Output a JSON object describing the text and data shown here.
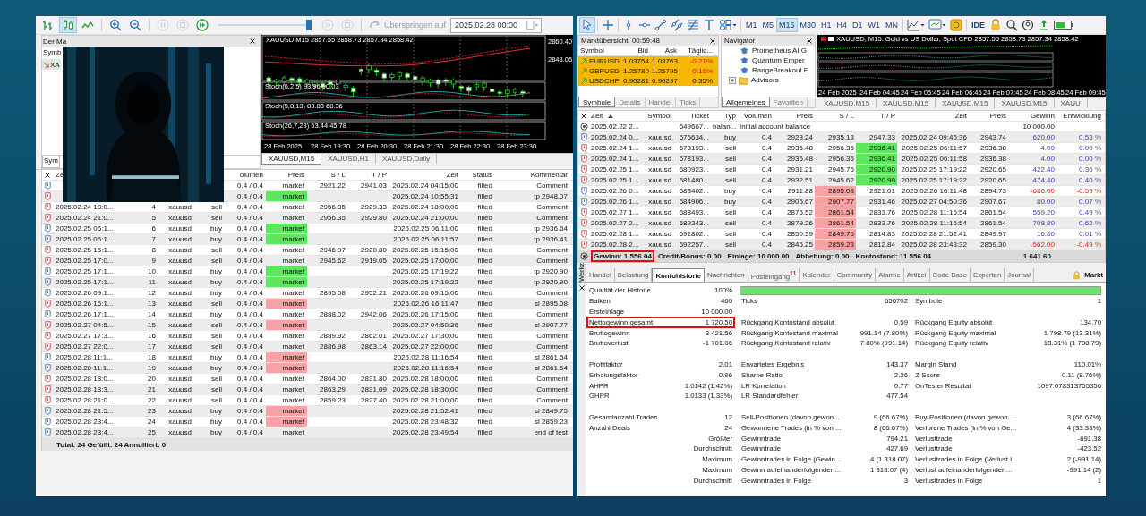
{
  "left_toolbar": {
    "tools": [
      {
        "kind": "bars",
        "selected": false,
        "disabled": false
      },
      {
        "kind": "candles",
        "selected": true,
        "disabled": false
      },
      {
        "kind": "line",
        "selected": false,
        "disabled": false
      },
      {
        "kind": "zoom-in",
        "selected": false,
        "disabled": false
      },
      {
        "kind": "zoom-out",
        "selected": false,
        "disabled": false
      },
      {
        "kind": "pause",
        "selected": false,
        "disabled": true
      },
      {
        "kind": "stop",
        "selected": false,
        "disabled": true
      },
      {
        "kind": "play",
        "selected": false,
        "disabled": false
      }
    ],
    "speed": {
      "level": 0.97
    },
    "after_tools": [
      {
        "kind": "forward",
        "selected": false,
        "disabled": true
      },
      {
        "kind": "stop",
        "selected": false,
        "disabled": true
      }
    ],
    "skip_label": "Überspringen auf",
    "date_field": {
      "value": "2025.02.28 00:00"
    }
  },
  "market_panel": {
    "title": "Der Ma",
    "column": "Symb",
    "row": "XA",
    "tab": "Sym"
  },
  "left_chart": {
    "title": "XAUUSD,M15  2857.55 2858.73 2857.34 2858.42",
    "price_labels": [
      "2860.40",
      "2848.05"
    ],
    "indicators": [
      "Stoch(6,2,5) 93.96 90.03",
      "Stoch(5,8,13) 83.83 68.36",
      "Stoch(26,7,28) 53.44 45.78"
    ],
    "time_labels": [
      "28 Feb 2025",
      "28 Feb 19:30",
      "28 Feb 20:30",
      "28 Feb 21:30",
      "28 Feb 22:30",
      "28 Feb 23:30"
    ],
    "tabs": [
      {
        "label": "XAUUSD,M15",
        "selected": true
      },
      {
        "label": "XAUUSD,H1",
        "selected": false
      },
      {
        "label": "XAUUSD,Daily",
        "selected": false
      }
    ]
  },
  "orders": {
    "header": {
      "zeit": "Ze",
      "volumen": "olumen",
      "preis": "Preis",
      "sl": "S / L",
      "tp": "T / P",
      "zeit2": "Zeit",
      "status": "Status",
      "kommentar": "Kommentar"
    },
    "rows": [
      {
        "kind": "buy",
        "tp_hit": false,
        "sl_hit": false,
        "volumen": "0.4 / 0.4",
        "preis": "market",
        "sl": "2921.22",
        "tp": "2941.03",
        "zeit2": "2025.02.24 04:15:00",
        "status": "filled",
        "kommentar": "Comment"
      },
      {
        "kind": "sell",
        "tp_hit": true,
        "sl_hit": false,
        "volumen": "0.4 / 0.4",
        "preis": "market",
        "zeit2": "2025.02.24 10:55:31",
        "status": "filled",
        "kommentar": "tp 2948.07"
      },
      {
        "kind": "sell",
        "tp_hit": false,
        "sl_hit": false,
        "zeit": "2025.02.24 18:0...",
        "order": "4",
        "symbol": "xauusd",
        "typ": "sell",
        "volumen": "0.4 / 0.4",
        "preis": "market",
        "sl": "2956.35",
        "tp": "2929.33",
        "zeit2": "2025.02.24 18:00:00",
        "status": "filled",
        "kommentar": "Comment"
      },
      {
        "kind": "sell",
        "tp_hit": false,
        "sl_hit": false,
        "zeit": "2025.02.24 21:0...",
        "order": "5",
        "symbol": "xauusd",
        "typ": "sell",
        "volumen": "0.4 / 0.4",
        "preis": "market",
        "sl": "2956.35",
        "tp": "2929.80",
        "zeit2": "2025.02.24 21:00:00",
        "status": "filled",
        "kommentar": "Comment"
      },
      {
        "kind": "buy",
        "tp_hit": true,
        "sl_hit": false,
        "zeit": "2025.02.25 06:1...",
        "order": "6",
        "symbol": "xauusd",
        "typ": "buy",
        "volumen": "0.4 / 0.4",
        "preis": "market",
        "zeit2": "2025.02.25 06:11:00",
        "status": "filled",
        "kommentar": "tp 2936.64"
      },
      {
        "kind": "buy",
        "tp_hit": true,
        "sl_hit": false,
        "zeit": "2025.02.25 06:1...",
        "order": "7",
        "symbol": "xauusd",
        "typ": "buy",
        "volumen": "0.4 / 0.4",
        "preis": "market",
        "zeit2": "2025.02.25 06:11:57",
        "status": "filled",
        "kommentar": "tp 2936.41"
      },
      {
        "kind": "sell",
        "tp_hit": false,
        "sl_hit": false,
        "zeit": "2025.02.25 15:1...",
        "order": "8",
        "symbol": "xauusd",
        "typ": "sell",
        "volumen": "0.4 / 0.4",
        "preis": "market",
        "sl": "2946.97",
        "tp": "2920.80",
        "zeit2": "2025.02.25 15:15:00",
        "status": "filled",
        "kommentar": "Comment"
      },
      {
        "kind": "sell",
        "tp_hit": false,
        "sl_hit": false,
        "zeit": "2025.02.25 17:0...",
        "order": "9",
        "symbol": "xauusd",
        "typ": "sell",
        "volumen": "0.4 / 0.4",
        "preis": "market",
        "sl": "2945.62",
        "tp": "2919.05",
        "zeit2": "2025.02.25 17:00:00",
        "status": "filled",
        "kommentar": "Comment"
      },
      {
        "kind": "buy",
        "tp_hit": true,
        "sl_hit": false,
        "zeit": "2025.02.25 17:1...",
        "order": "10",
        "symbol": "xauusd",
        "typ": "buy",
        "volumen": "0.4 / 0.4",
        "preis": "market",
        "zeit2": "2025.02.25 17:19:22",
        "status": "filled",
        "kommentar": "tp 2920.90"
      },
      {
        "kind": "buy",
        "tp_hit": true,
        "sl_hit": false,
        "zeit": "2025.02.25 17:1...",
        "order": "11",
        "symbol": "xauusd",
        "typ": "buy",
        "volumen": "0.4 / 0.4",
        "preis": "market",
        "zeit2": "2025.02.25 17:19:22",
        "status": "filled",
        "kommentar": "tp 2920.90"
      },
      {
        "kind": "buy",
        "tp_hit": false,
        "sl_hit": false,
        "zeit": "2025.02.26 09:1...",
        "order": "12",
        "symbol": "xauusd",
        "typ": "buy",
        "volumen": "0.4 / 0.4",
        "preis": "market",
        "sl": "2895.08",
        "tp": "2952.21",
        "zeit2": "2025.02.26 09:15:00",
        "status": "filled",
        "kommentar": "Comment"
      },
      {
        "kind": "sell",
        "tp_hit": false,
        "sl_hit": true,
        "zeit": "2025.02.26 16:1...",
        "order": "13",
        "symbol": "xauusd",
        "typ": "sell",
        "volumen": "0.4 / 0.4",
        "preis": "market",
        "zeit2": "2025.02.26 16:11:47",
        "status": "filled",
        "kommentar": "sl 2895.08"
      },
      {
        "kind": "buy",
        "tp_hit": false,
        "sl_hit": false,
        "zeit": "2025.02.26 17:1...",
        "order": "14",
        "symbol": "xauusd",
        "typ": "buy",
        "volumen": "0.4 / 0.4",
        "preis": "market",
        "sl": "2888.02",
        "tp": "2942.06",
        "zeit2": "2025.02.26 17:15:00",
        "status": "filled",
        "kommentar": "Comment"
      },
      {
        "kind": "sell",
        "tp_hit": false,
        "sl_hit": true,
        "zeit": "2025.02.27 04:5...",
        "order": "15",
        "symbol": "xauusd",
        "typ": "sell",
        "volumen": "0.4 / 0.4",
        "preis": "market",
        "zeit2": "2025.02.27 04:50:36",
        "status": "filled",
        "kommentar": "sl 2907.77"
      },
      {
        "kind": "sell",
        "tp_hit": false,
        "sl_hit": false,
        "zeit": "2025.02.27 17:3...",
        "order": "16",
        "symbol": "xauusd",
        "typ": "sell",
        "volumen": "0.4 / 0.4",
        "preis": "market",
        "sl": "2889.92",
        "tp": "2862.01",
        "zeit2": "2025.02.27 17:30:00",
        "status": "filled",
        "kommentar": "Comment"
      },
      {
        "kind": "sell",
        "tp_hit": false,
        "sl_hit": false,
        "zeit": "2025.02.27 22:0...",
        "order": "17",
        "symbol": "xauusd",
        "typ": "sell",
        "volumen": "0.4 / 0.4",
        "preis": "market",
        "sl": "2886.98",
        "tp": "2863.14",
        "zeit2": "2025.02.27 22:00:00",
        "status": "filled",
        "kommentar": "Comment"
      },
      {
        "kind": "buy",
        "tp_hit": false,
        "sl_hit": true,
        "zeit": "2025.02.28 11:1...",
        "order": "18",
        "symbol": "xauusd",
        "typ": "buy",
        "volumen": "0.4 / 0.4",
        "preis": "market",
        "zeit2": "2025.02.28 11:16:54",
        "status": "filled",
        "kommentar": "sl 2861.54"
      },
      {
        "kind": "buy",
        "tp_hit": false,
        "sl_hit": true,
        "zeit": "2025.02.28 11:1...",
        "order": "19",
        "symbol": "xauusd",
        "typ": "buy",
        "volumen": "0.4 / 0.4",
        "preis": "market",
        "zeit2": "2025.02.28 11:16:54",
        "status": "filled",
        "kommentar": "sl 2861.54"
      },
      {
        "kind": "sell",
        "tp_hit": false,
        "sl_hit": false,
        "zeit": "2025.02.28 18:0...",
        "order": "20",
        "symbol": "xauusd",
        "typ": "sell",
        "volumen": "0.4 / 0.4",
        "preis": "market",
        "sl": "2864.00",
        "tp": "2831.80",
        "zeit2": "2025.02.28 18:00:00",
        "status": "filled",
        "kommentar": "Comment"
      },
      {
        "kind": "sell",
        "tp_hit": false,
        "sl_hit": false,
        "zeit": "2025.02.28 18:3...",
        "order": "21",
        "symbol": "xauusd",
        "typ": "sell",
        "volumen": "0.4 / 0.4",
        "preis": "market",
        "sl": "2863.29",
        "tp": "2831.09",
        "zeit2": "2025.02.28 18:30:00",
        "status": "filled",
        "kommentar": "Comment"
      },
      {
        "kind": "sell",
        "tp_hit": false,
        "sl_hit": false,
        "zeit": "2025.02.28 21:0...",
        "order": "22",
        "symbol": "xauusd",
        "typ": "sell",
        "volumen": "0.4 / 0.4",
        "preis": "market",
        "sl": "2859.23",
        "tp": "2827.40",
        "zeit2": "2025.02.28 21:00:00",
        "status": "filled",
        "kommentar": "Comment"
      },
      {
        "kind": "buy",
        "tp_hit": false,
        "sl_hit": true,
        "zeit": "2025.02.28 21:5...",
        "order": "23",
        "symbol": "xauusd",
        "typ": "buy",
        "volumen": "0.4 / 0.4",
        "preis": "market",
        "zeit2": "2025.02.28 21:52:41",
        "status": "filled",
        "kommentar": "sl 2849.75"
      },
      {
        "kind": "buy",
        "tp_hit": false,
        "sl_hit": true,
        "zeit": "2025.02.28 23:4...",
        "order": "24",
        "symbol": "xauusd",
        "typ": "buy",
        "volumen": "0.4 / 0.4",
        "preis": "market",
        "zeit2": "2025.02.28 23:48:32",
        "status": "filled",
        "kommentar": "sl 2859.23"
      },
      {
        "kind": "buy",
        "tp_hit": false,
        "sl_hit": false,
        "zeit": "2025.02.28 23:4...",
        "order": "25",
        "symbol": "xauusd",
        "typ": "buy",
        "volumen": "0.4 / 0.4",
        "preis": "market",
        "zeit2": "2025.02.28 23:49:54",
        "status": "filled",
        "kommentar": "end of test"
      }
    ],
    "footer": "Total: 24  Gefüllt: 24  Annulliert: 0"
  },
  "right_toolbar": {
    "tools": [
      {
        "kind": "cursor",
        "selected": true
      },
      {
        "kind": "crosshair",
        "selected": false
      },
      {
        "kind": "vline",
        "selected": false
      },
      {
        "kind": "hline",
        "selected": false
      },
      {
        "kind": "trendline",
        "selected": false
      },
      {
        "kind": "channel",
        "selected": false
      },
      {
        "kind": "levels",
        "selected": false
      },
      {
        "kind": "text",
        "selected": false
      },
      {
        "kind": "shapes",
        "selected": false
      }
    ],
    "timeframes": [
      {
        "label": "M1",
        "selected": false
      },
      {
        "label": "M5",
        "selected": false
      },
      {
        "label": "M15",
        "selected": true
      },
      {
        "label": "M30",
        "selected": false
      },
      {
        "label": "H1",
        "selected": false
      },
      {
        "label": "H4",
        "selected": false
      },
      {
        "label": "D1",
        "selected": false
      },
      {
        "label": "W1",
        "selected": false
      },
      {
        "label": "MN",
        "selected": false
      }
    ],
    "ide": "IDE"
  },
  "market_watch": {
    "title": "Marktübersicht: 00:59:48",
    "columns": [
      "Symbol",
      "Bid",
      "Ask",
      "Täglic..."
    ],
    "rows": [
      {
        "symbol": "EURUSD",
        "bid": "1.03754",
        "ask": "1.03763",
        "change": "-0.21%",
        "negative": true
      },
      {
        "symbol": "GBPUSD",
        "bid": "1.25780",
        "ask": "1.25795",
        "change": "-0.16%",
        "negative": true
      },
      {
        "symbol": "USDCHF",
        "bid": "0.90281",
        "ask": "0.90297",
        "change": "0.35%",
        "negative": false
      }
    ],
    "tabs": [
      {
        "label": "Symbole",
        "selected": true
      },
      {
        "label": "Details",
        "selected": false
      },
      {
        "label": "Handel",
        "selected": false
      },
      {
        "label": "Ticks",
        "selected": false
      }
    ]
  },
  "navigator": {
    "title": "Navigator",
    "items": [
      {
        "label": "Prometheus AI G",
        "kind": "expert"
      },
      {
        "label": "Quantum Emper",
        "kind": "expert"
      },
      {
        "label": "RangeBreakout E",
        "kind": "expert"
      },
      {
        "label": "Advisors",
        "kind": "folder"
      }
    ],
    "tabs": [
      {
        "label": "Allgemeines",
        "selected": true
      },
      {
        "label": "Favoriten",
        "selected": false
      }
    ]
  },
  "mini_chart": {
    "title": "XAUUSD, M15: Gold vs US Dollar, Spot CFD 2857.55 2858.73 2857.34 2858.42",
    "time_labels": [
      "24 Feb 2025",
      "24 Feb 04:45",
      "24 Feb 05:45",
      "24 Feb 06:45",
      "24 Feb 07:45",
      "24 Feb 08:45",
      "24 Feb 09:45"
    ],
    "tabs": [
      {
        "label": "XAUUSD,M15",
        "selected": false
      },
      {
        "label": "XAUUSD,M15",
        "selected": false
      },
      {
        "label": "XAUUSD,M15",
        "selected": false
      },
      {
        "label": "XAUUSD,M15",
        "selected": false
      },
      {
        "label": "XAUU",
        "selected": false
      }
    ]
  },
  "deals": {
    "columns": [
      "Zeit",
      "Symbol",
      "Ticket",
      "Typ",
      "Volumen",
      "Preis",
      "S / L",
      "T / P",
      "Zeit",
      "Preis",
      "Gewinn",
      "Entwicklung"
    ],
    "rows": [
      {
        "kind": "balance",
        "zeit": "2025.02.22 2...",
        "ticket": "649667...",
        "typ": "balan...",
        "volumen": "Initial account balance",
        "gewinn": "10 000.00"
      },
      {
        "kind": "buy",
        "tp_hit": false,
        "sl_hit": false,
        "loss": false,
        "zeit": "2025.02.24 0...",
        "symbol": "xauusd",
        "ticket": "675634...",
        "typ": "buy",
        "volumen": "0.4",
        "preis": "2928.24",
        "sl": "2935.13",
        "tp": "2947.33",
        "zeit2": "2025.02.24 09:45:36",
        "preis2": "2943.74",
        "gewinn": "620.00",
        "entw": "0.53 %"
      },
      {
        "kind": "sell",
        "tp_hit": true,
        "sl_hit": false,
        "loss": false,
        "zeit": "2025.02.24 1...",
        "symbol": "xauusd",
        "ticket": "678193...",
        "typ": "sell",
        "volumen": "0.4",
        "preis": "2936.48",
        "sl": "2956.35",
        "tp": "2936.41",
        "zeit2": "2025.02.25 06:11:57",
        "preis2": "2936.38",
        "gewinn": "4.00",
        "entw": "0.00 %"
      },
      {
        "kind": "sell",
        "tp_hit": true,
        "sl_hit": false,
        "loss": false,
        "zeit": "2025.02.24 1...",
        "symbol": "xauusd",
        "ticket": "678193...",
        "typ": "sell",
        "volumen": "0.4",
        "preis": "2936.48",
        "sl": "2956.35",
        "tp": "2936.41",
        "zeit2": "2025.02.25 06:11:58",
        "preis2": "2936.38",
        "gewinn": "4.00",
        "entw": "0.00 %"
      },
      {
        "kind": "sell",
        "tp_hit": true,
        "sl_hit": false,
        "loss": false,
        "zeit": "2025.02.25 1...",
        "symbol": "xauusd",
        "ticket": "680923...",
        "typ": "sell",
        "volumen": "0.4",
        "preis": "2931.21",
        "sl": "2945.75",
        "tp": "2920.90",
        "zeit2": "2025.02.25 17:19:22",
        "preis2": "2920.65",
        "gewinn": "422.40",
        "entw": "0.36 %"
      },
      {
        "kind": "sell",
        "tp_hit": true,
        "sl_hit": false,
        "loss": false,
        "zeit": "2025.02.25 1...",
        "symbol": "xauusd",
        "ticket": "681480...",
        "typ": "sell",
        "volumen": "0.4",
        "preis": "2932.51",
        "sl": "2945.62",
        "tp": "2920.90",
        "zeit2": "2025.02.25 17:19:22",
        "preis2": "2920.65",
        "gewinn": "474.40",
        "entw": "0.40 %"
      },
      {
        "kind": "buy",
        "tp_hit": false,
        "sl_hit": true,
        "loss": true,
        "zeit": "2025.02.26 0...",
        "symbol": "xauusd",
        "ticket": "683402...",
        "typ": "buy",
        "volumen": "0.4",
        "preis": "2911.88",
        "sl": "2895.08",
        "tp": "2921.01",
        "zeit2": "2025.02.26 16:11:48",
        "preis2": "2894.73",
        "gewinn": "-686.00",
        "entw": "-0.59 %"
      },
      {
        "kind": "buy",
        "tp_hit": false,
        "sl_hit": true,
        "loss": false,
        "zeit": "2025.02.26 1...",
        "symbol": "xauusd",
        "ticket": "684906...",
        "typ": "buy",
        "volumen": "0.4",
        "preis": "2905.67",
        "sl": "2907.77",
        "tp": "2931.46",
        "zeit2": "2025.02.27 04:50:36",
        "preis2": "2907.67",
        "gewinn": "80.00",
        "entw": "0.07 %"
      },
      {
        "kind": "sell",
        "tp_hit": false,
        "sl_hit": true,
        "loss": false,
        "zeit": "2025.02.27 1...",
        "symbol": "xauusd",
        "ticket": "688493...",
        "typ": "sell",
        "volumen": "0.4",
        "preis": "2875.52",
        "sl": "2861.54",
        "tp": "2833.76",
        "zeit2": "2025.02.28 11:16:54",
        "preis2": "2861.54",
        "gewinn": "559.20",
        "entw": "0.49 %"
      },
      {
        "kind": "sell",
        "tp_hit": false,
        "sl_hit": true,
        "loss": false,
        "zeit": "2025.02.27 2...",
        "symbol": "xauusd",
        "ticket": "689243...",
        "typ": "sell",
        "volumen": "0.4",
        "preis": "2879.26",
        "sl": "2861.54",
        "tp": "2833.76",
        "zeit2": "2025.02.28 11:16:54",
        "preis2": "2861.54",
        "gewinn": "708.80",
        "entw": "0.62 %"
      },
      {
        "kind": "sell",
        "tp_hit": false,
        "sl_hit": true,
        "loss": false,
        "zeit": "2025.02.28 1...",
        "symbol": "xauusd",
        "ticket": "691802...",
        "typ": "sell",
        "volumen": "0.4",
        "preis": "2850.39",
        "sl": "2849.75",
        "tp": "2814.83",
        "zeit2": "2025.02.28 21:52:41",
        "preis2": "2849.97",
        "gewinn": "16.80",
        "entw": "0.01 %"
      },
      {
        "kind": "sell",
        "tp_hit": false,
        "sl_hit": true,
        "loss": true,
        "zeit": "2025.02.28 2...",
        "symbol": "xauusd",
        "ticket": "692257...",
        "typ": "sell",
        "volumen": "0.4",
        "preis": "2845.25",
        "sl": "2859.23",
        "tp": "2812.84",
        "zeit2": "2025.02.28 23:48:32",
        "preis2": "2859.30",
        "gewinn": "-562.00",
        "entw": "-0.49 %"
      }
    ],
    "summary": [
      {
        "text": "Gewinn: 1 556.04",
        "highlighted": true
      },
      {
        "text": "Credit/Bonus: 0.00",
        "highlighted": false
      },
      {
        "text": "Einlage: 10 000.00",
        "highlighted": false
      },
      {
        "text": "Abhebung: 0.00",
        "highlighted": false
      },
      {
        "text": "Kontostand: 11 556.04",
        "highlighted": false
      }
    ],
    "total": "1 641.60"
  },
  "toolbox": {
    "side_label": "Werkz",
    "tabs": [
      {
        "label": "Handel",
        "selected": false
      },
      {
        "label": "Belastung",
        "selected": false
      },
      {
        "label": "Kontohistorie",
        "selected": true
      },
      {
        "label": "Nachrichten",
        "selected": false
      },
      {
        "label": "Posteingang",
        "badge": "11",
        "selected": false
      },
      {
        "label": "Kalender",
        "selected": false
      },
      {
        "label": "Community",
        "selected": false
      },
      {
        "label": "Alarme",
        "selected": false
      },
      {
        "label": "Artikel",
        "selected": false
      },
      {
        "label": "Code Base",
        "selected": false
      },
      {
        "label": "Experten",
        "selected": false
      },
      {
        "label": "Journal",
        "selected": false
      }
    ],
    "market_tab": "Markt"
  },
  "report": {
    "rows": [
      {
        "kind": "quality",
        "highlighted": false,
        "cells": [
          {
            "label": "Qualität der Historie",
            "value": "100%"
          }
        ],
        "level": 1
      },
      {
        "kind": "stats",
        "highlighted": false,
        "cells": [
          {
            "label": "Balken",
            "value": "460"
          },
          {
            "label": "Ticks",
            "value": "656702"
          },
          {
            "label": "Symbole",
            "value": "1"
          }
        ]
      },
      {
        "kind": "stats",
        "highlighted": false,
        "cells": [
          {
            "label": "Ersteinlage",
            "value": "10 000.00"
          }
        ]
      },
      {
        "kind": "stats",
        "highlighted": true,
        "cells": [
          {
            "label": "Nettogewinn gesamt",
            "value": "1 720.50"
          },
          {
            "label": "Rückgang Kontostand absolut",
            "value": "0.59"
          },
          {
            "label": "Rückgang Equity absolut",
            "value": "134.70"
          }
        ]
      },
      {
        "kind": "stats",
        "highlighted": false,
        "cells": [
          {
            "label": "Bruttogewinn",
            "value": "3 421.56"
          },
          {
            "label": "Rückgang Kontostand maximal",
            "value": "991.14 (7.80%)"
          },
          {
            "label": "Rückgang Equity maximal",
            "value": "1 798.79 (13.31%)"
          }
        ]
      },
      {
        "kind": "stats",
        "highlighted": false,
        "cells": [
          {
            "label": "Bruttoverlust",
            "value": "-1 701.06"
          },
          {
            "label": "Rückgang Kontostand relativ",
            "value": "7.80% (991.14)"
          },
          {
            "label": "Rückgang Equity relativ",
            "value": "13.31% (1 798.79)"
          }
        ]
      },
      {
        "kind": "blank",
        "highlighted": false
      },
      {
        "kind": "stats",
        "highlighted": false,
        "cells": [
          {
            "label": "Profitfaktor",
            "value": "2.01"
          },
          {
            "label": "Erwartetes Ergebnis",
            "value": "143.37"
          },
          {
            "label": "Margin Stand",
            "value": "110.01%"
          }
        ]
      },
      {
        "kind": "stats",
        "highlighted": false,
        "cells": [
          {
            "label": "Erholungsfaktor",
            "value": "0.96"
          },
          {
            "label": "Sharpe-Ratio",
            "value": "2.26"
          },
          {
            "label": "Z-Score",
            "value": "0.11 (8.76%)"
          }
        ]
      },
      {
        "kind": "stats",
        "highlighted": false,
        "cells": [
          {
            "label": "AHPR",
            "value": "1.0142 (1.42%)"
          },
          {
            "label": "LR Korrelation",
            "value": "0.77"
          },
          {
            "label": "OnTester Resultat",
            "value": "1097.078313755356"
          }
        ]
      },
      {
        "kind": "stats",
        "highlighted": false,
        "cells": [
          {
            "label": "GHPR",
            "value": "1.0133 (1.33%)"
          },
          {
            "label": "LR Standardfehler",
            "value": "477.54"
          }
        ]
      },
      {
        "kind": "blank",
        "highlighted": false
      },
      {
        "kind": "stats",
        "highlighted": false,
        "cells": [
          {
            "label": "Gesamtanzahl Trades",
            "value": "12"
          },
          {
            "label": "Sell-Positionen (davon gewon...",
            "value": "9 (66.67%)"
          },
          {
            "label": "Buy-Positionen (davon gewon...",
            "value": "3 (66.67%)"
          }
        ]
      },
      {
        "kind": "stats",
        "highlighted": false,
        "cells": [
          {
            "label": "Anzahl Deals",
            "value": "24"
          },
          {
            "label": "Gewonnene Trades (in % von ...",
            "value": "8 (66.67%)"
          },
          {
            "label": "Verlorene Trades (in % von Ge...",
            "value": "4 (33.33%)"
          }
        ]
      },
      {
        "kind": "stats",
        "highlighted": false,
        "cells": [
          {
            "value": "Größter"
          },
          {
            "label": "Gewinntrade",
            "value": "794.21"
          },
          {
            "label": "Verlusttrade",
            "value": "-691.38"
          }
        ]
      },
      {
        "kind": "stats",
        "highlighted": false,
        "cells": [
          {
            "value": "Durchschnitt"
          },
          {
            "label": "Gewinntrade",
            "value": "427.69"
          },
          {
            "label": "Verlusttrade",
            "value": "-423.52"
          }
        ]
      },
      {
        "kind": "stats",
        "highlighted": false,
        "cells": [
          {
            "value": "Maximum"
          },
          {
            "label": "Gewinntrades in Folge (Gewin...",
            "value": "4 (1 318.07)"
          },
          {
            "label": "Verlusttrades in Folge (Verlust i...",
            "value": "2 (-991.14)"
          }
        ]
      },
      {
        "kind": "stats",
        "highlighted": false,
        "cells": [
          {
            "value": "Maximum"
          },
          {
            "label": "Gewinn aufeinanderfolgender ...",
            "value": "1 318.07 (4)"
          },
          {
            "label": "Verlust aufeinanderfolgender ...",
            "value": "-991.14 (2)"
          }
        ]
      },
      {
        "kind": "stats",
        "highlighted": false,
        "cells": [
          {
            "value": "Durchschnitt"
          },
          {
            "label": "Gewinntrades in Folge",
            "value": "3"
          },
          {
            "label": "Verlusttrades in Folge",
            "value": "1"
          }
        ]
      }
    ]
  }
}
